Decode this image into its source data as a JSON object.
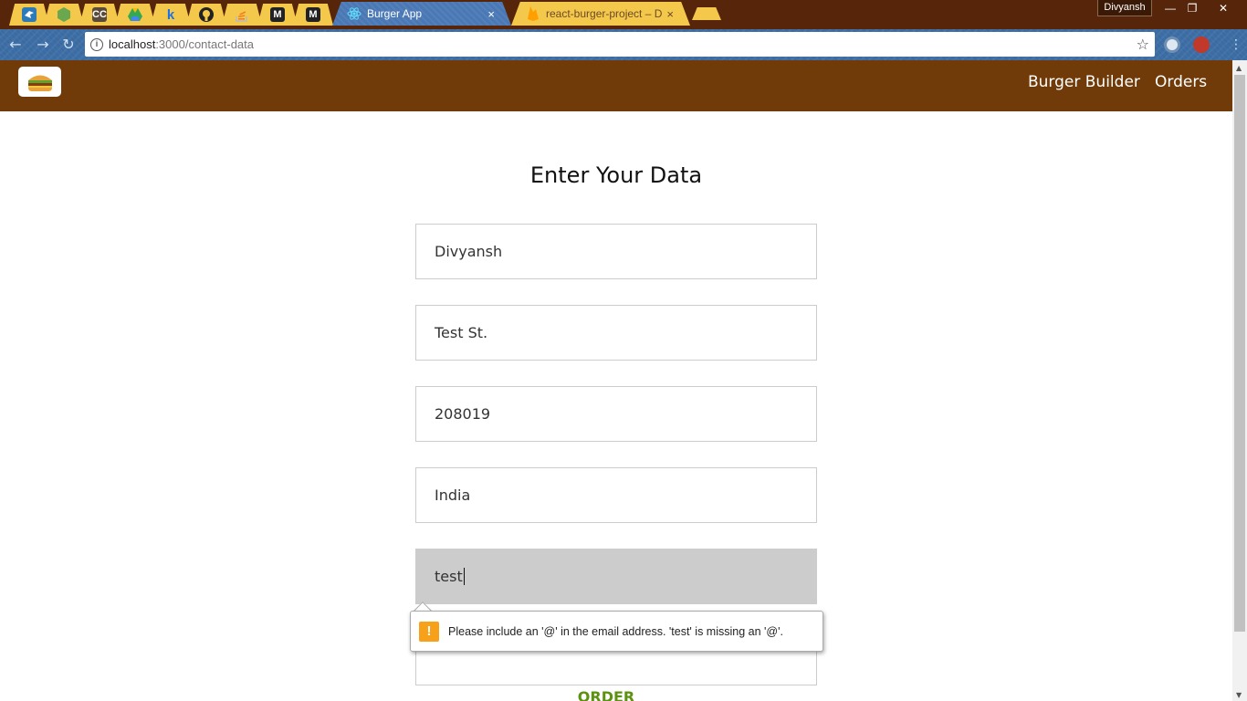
{
  "browser": {
    "pinned_tabs": [
      {
        "icon": "bird-icon",
        "color": "#2c7ab8"
      },
      {
        "icon": "nodejs-icon",
        "color": "#6aa84f"
      },
      {
        "icon": "cc-icon",
        "color": "#5a4a3a",
        "text": "CC"
      },
      {
        "icon": "drive-icon",
        "color": "#34a853"
      },
      {
        "icon": "k-icon",
        "color": "#1a73e8",
        "text": "k"
      },
      {
        "icon": "github-icon",
        "color": "#222222"
      },
      {
        "icon": "stackoverflow-icon",
        "color": "#f48024"
      },
      {
        "icon": "medium-icon",
        "color": "#222222",
        "text": "M"
      },
      {
        "icon": "medium-icon",
        "color": "#222222",
        "text": "M"
      }
    ],
    "active_tab": {
      "title": "Burger App",
      "close": "×"
    },
    "inactive_tab": {
      "title": "react-burger-project – D",
      "close": "×"
    },
    "profile": "Divyansh",
    "window_controls": {
      "minimize": "—",
      "restore": "❐",
      "close": "✕"
    },
    "address": {
      "host": "localhost",
      "path": ":3000/contact-data"
    }
  },
  "navbar": {
    "links": [
      "Burger Builder",
      "Orders"
    ]
  },
  "form": {
    "title": "Enter Your Data",
    "fields": [
      {
        "name": "name",
        "value": "Divyansh"
      },
      {
        "name": "street",
        "value": "Test St."
      },
      {
        "name": "zip",
        "value": "208019"
      },
      {
        "name": "country",
        "value": "India"
      },
      {
        "name": "email",
        "value": "test"
      }
    ],
    "validation_message": "Please include an '@' in the email address. 'test' is missing an '@'.",
    "order_button": "ORDER"
  },
  "colors": {
    "navbar": "#703b09",
    "order_text": "#5c9210",
    "warning": "#f7a11a"
  }
}
